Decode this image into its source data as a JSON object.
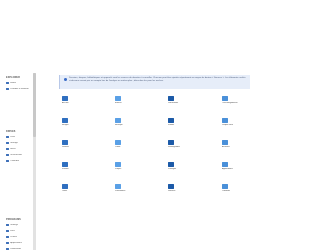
{
  "sidebar": {
    "sections": [
      {
        "title": "EXPLORER",
        "items": [
          "Home",
          "Portable & network"
        ]
      },
      {
        "title": "DRIVES",
        "items": [
          "Drive",
          "Storage",
          "Music",
          "Screenshots",
          "Calendar"
        ]
      },
      {
        "title": "PROGRAMS",
        "items": [
          "Settings",
          "Files",
          "Photos",
          "Applications",
          "Downloads"
        ]
      }
    ]
  },
  "info": {
    "text": "Dossiers, disques, bibliothèques et appareils sont les sources de données à surveiller. Chacune peut être ajoutée séparément au moyen du bouton « Sources ». Les éléments cochés ci-dessous seront pris en compte lors de l'analyse en arrière-plan ; décochez-les pour les exclure."
  },
  "grid": {
    "tiles": [
      {
        "label": "Accueil"
      },
      {
        "label": "Bureau"
      },
      {
        "label": "Documents"
      },
      {
        "label": "Téléchargements"
      },
      {
        "label": "Images"
      },
      {
        "label": "Musique"
      },
      {
        "label": "Vidéos"
      },
      {
        "label": "Disque local"
      },
      {
        "label": "Réseau"
      },
      {
        "label": "Cloud"
      },
      {
        "label": "Sauvegardes"
      },
      {
        "label": "Archives"
      },
      {
        "label": "Favoris"
      },
      {
        "label": "Projets"
      },
      {
        "label": "Partagés"
      },
      {
        "label": "Applications"
      },
      {
        "label": "Outils"
      },
      {
        "label": "Paramètres"
      },
      {
        "label": "Récents"
      },
      {
        "label": "Corbeille"
      }
    ]
  },
  "colors": {
    "accent": "#3d6fb8",
    "info_bg": "#e6edf9"
  }
}
